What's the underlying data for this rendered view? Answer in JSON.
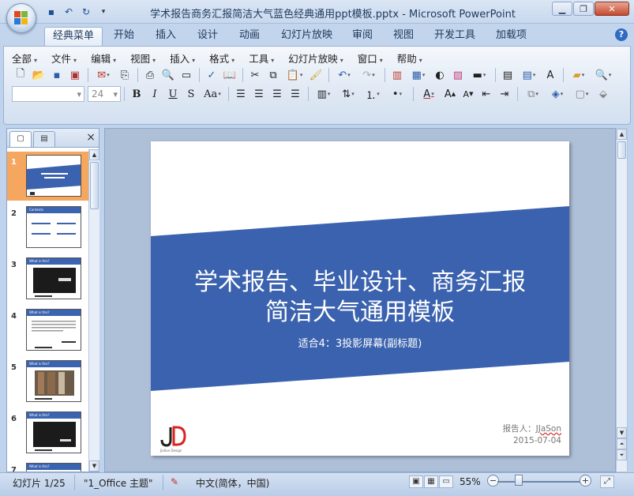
{
  "window": {
    "title": "学术报告商务汇报简洁大气蓝色经典通用ppt模板.pptx - Microsoft PowerPoint",
    "minimize_icon": "minimize-icon",
    "maximize_icon": "restore-icon",
    "close_icon": "close-icon"
  },
  "quick_access": {
    "save": "save-icon",
    "undo": "undo-icon",
    "redo": "redo-icon",
    "customize": "customize-icon"
  },
  "ribbon_tabs": [
    "经典菜单",
    "开始",
    "插入",
    "设计",
    "动画",
    "幻灯片放映",
    "审阅",
    "视图",
    "开发工具",
    "加载项"
  ],
  "active_tab": "经典菜单",
  "classic_menu": [
    "全部",
    "文件",
    "编辑",
    "视图",
    "插入",
    "格式",
    "工具",
    "幻灯片放映",
    "窗口",
    "帮助"
  ],
  "font": {
    "name": "",
    "size": "24"
  },
  "format_buttons": {
    "bold": "B",
    "italic": "I",
    "underline": "U",
    "strike": "S",
    "case": "Aa"
  },
  "slide_pane": {
    "tabs": [
      "slides-tab-icon",
      "outline-tab-icon"
    ],
    "close": "×",
    "slides": [
      {
        "num": "1",
        "head": "",
        "selected": true
      },
      {
        "num": "2",
        "head": "Contents",
        "selected": false
      },
      {
        "num": "3",
        "head": "What is this?",
        "selected": false
      },
      {
        "num": "4",
        "head": "What is this?",
        "selected": false
      },
      {
        "num": "5",
        "head": "What is this?",
        "selected": false
      },
      {
        "num": "6",
        "head": "What is this?",
        "selected": false
      },
      {
        "num": "7",
        "head": "What is this?",
        "selected": false
      }
    ]
  },
  "slide": {
    "title_line1": "学术报告、毕业设计、商务汇报",
    "title_line2": "简洁大气通用模板",
    "subtitle": "适合4：3投影屏幕(副标题)",
    "presenter_label": "报告人：",
    "presenter_name": "JJaSon",
    "date": "2015-07-04",
    "logo_text": "JD",
    "logo_caption": "JiaSon Design",
    "band_color": "#3b62ae"
  },
  "status": {
    "slide_counter": "幻灯片 1/25",
    "theme": "\"1_Office 主题\"",
    "language": "中文(简体，中国)",
    "zoom": "55%",
    "zoom_fraction": 0.25
  }
}
